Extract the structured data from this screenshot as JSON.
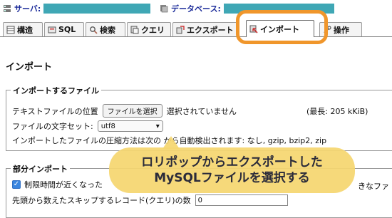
{
  "breadcrumb": {
    "server_label": "サーバ:",
    "database_label": "データベース:"
  },
  "tabs": [
    {
      "label": "構造",
      "icon": "structure-icon"
    },
    {
      "label": "SQL",
      "icon": "sql-icon"
    },
    {
      "label": "検索",
      "icon": "search-icon"
    },
    {
      "label": "クエリ",
      "icon": "query-icon"
    },
    {
      "label": "エクスポート",
      "icon": "export-icon"
    },
    {
      "label": "インポート",
      "icon": "import-icon",
      "active": true
    },
    {
      "label": "操作",
      "icon": "operations-icon"
    }
  ],
  "page_title": "インポート",
  "import_file": {
    "legend": "インポートするファイル",
    "file_location_label": "テキストファイルの位置",
    "choose_file_button": "ファイルを選択",
    "no_file_text": "選択されていません",
    "max_size": "(最長: 205 kKiB)",
    "charset_label": "ファイルの文字セット:",
    "charset_value": "utf8",
    "compression_text": "インポートしたファイルの圧縮方法は次の から自動検出されます: なし, gzip, bzip2, zip"
  },
  "partial_import": {
    "legend": "部分インポート",
    "time_limit_text": "制限時間が近くなった",
    "time_limit_tail": "きなファ",
    "skip_label": "先頭から数えたスキップするレコード(クエリ)の数",
    "skip_value": "0"
  },
  "callout": {
    "line1": "ロリポップからエクスポートした",
    "line2": "MySQLファイルを選択する"
  },
  "colors": {
    "highlight": "#f0962b",
    "callout_bg": "#f5d670",
    "crumb_label": "#1a2a99",
    "redaction": "#3fa7b5"
  }
}
